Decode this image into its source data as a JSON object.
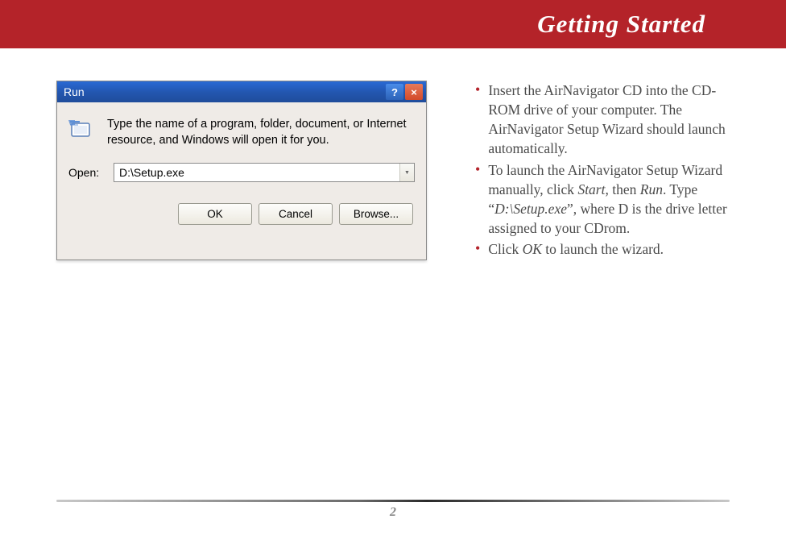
{
  "header": {
    "title": "Getting Started"
  },
  "dialog": {
    "title": "Run",
    "help_symbol": "?",
    "close_symbol": "×",
    "instruction": "Type the name of a program, folder, document, or Internet resource, and Windows will open it for you.",
    "open_label": "Open:",
    "open_value": "D:\\Setup.exe",
    "buttons": {
      "ok": "OK",
      "cancel": "Cancel",
      "browse": "Browse..."
    }
  },
  "steps": {
    "b1": "Insert the AirNavigator CD into the CD-ROM drive of your computer. The AirNavigator Setup Wizard should launch automatically.",
    "b2_pre": "To launch the AirNavigator Setup Wizard manually, click ",
    "b2_start": "Start",
    "b2_mid1": ", then ",
    "b2_run": "Run",
    "b2_mid2": ".  Type “",
    "b2_cmd": "D:\\Setup.exe",
    "b2_post": "”, where D is the drive letter assigned to your CDrom.",
    "b3_pre": "Click ",
    "b3_ok": "OK",
    "b3_post": " to launch the wizard."
  },
  "footer": {
    "page": "2"
  }
}
